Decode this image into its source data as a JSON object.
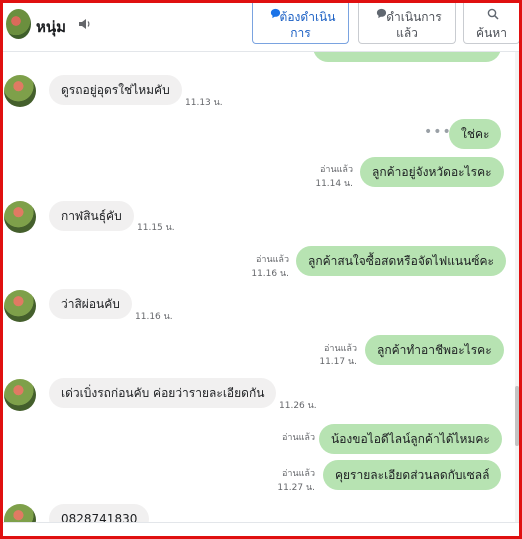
{
  "header": {
    "contact_name": "หนุ่ม",
    "buttons": [
      {
        "line1": "ต้องดำเนิน",
        "line2": "การ",
        "icon": "chat-bubble-icon"
      },
      {
        "line1": "ดำเนินการ",
        "line2": "แล้ว",
        "icon": "chat-bubble-icon"
      },
      {
        "line1": "",
        "line2": "ค้นหา",
        "icon": "search-icon"
      }
    ]
  },
  "messages": [
    {
      "dir": "in",
      "text": "ดูรถอยู่อุดรใช่ไหมคับ",
      "time": "11.13 น."
    },
    {
      "dir": "out",
      "text": "ใช่คะ"
    },
    {
      "dir": "out",
      "text": "ลูกค้าอยู่จังหวัดอะไรคะ",
      "read": "อ่านแล้ว",
      "time": "11.14 น."
    },
    {
      "dir": "in",
      "text": "กาฬสินธุ์คับ",
      "time": "11.15 น."
    },
    {
      "dir": "out",
      "text": "ลูกค้าสนใจซื้อสดหรือจัดไฟแนนซ์คะ",
      "read": "อ่านแล้ว",
      "time": "11.16 น."
    },
    {
      "dir": "in",
      "text": "ว่าสิผ่อนคับ",
      "time": "11.16 น."
    },
    {
      "dir": "out",
      "text": "ลูกค้าทำอาชีพอะไรคะ",
      "read": "อ่านแล้ว",
      "time": "11.17 น."
    },
    {
      "dir": "in",
      "text": "เด่วเบิ่งรถก่อนคับ ค่อยว่ารายละเอียดกัน",
      "time": "11.26 น."
    },
    {
      "dir": "out",
      "text": "น้องขอไอดีไลน์ลูกค้าได้ไหมคะ",
      "read": "อ่านแล้ว"
    },
    {
      "dir": "out",
      "text": "คุยรายละเอียดส่วนลดกับเซลล์",
      "read": "อ่านแล้ว",
      "time": "11.27 น."
    },
    {
      "dir": "in",
      "text": "0828741830"
    }
  ],
  "typing_dots": "•••"
}
